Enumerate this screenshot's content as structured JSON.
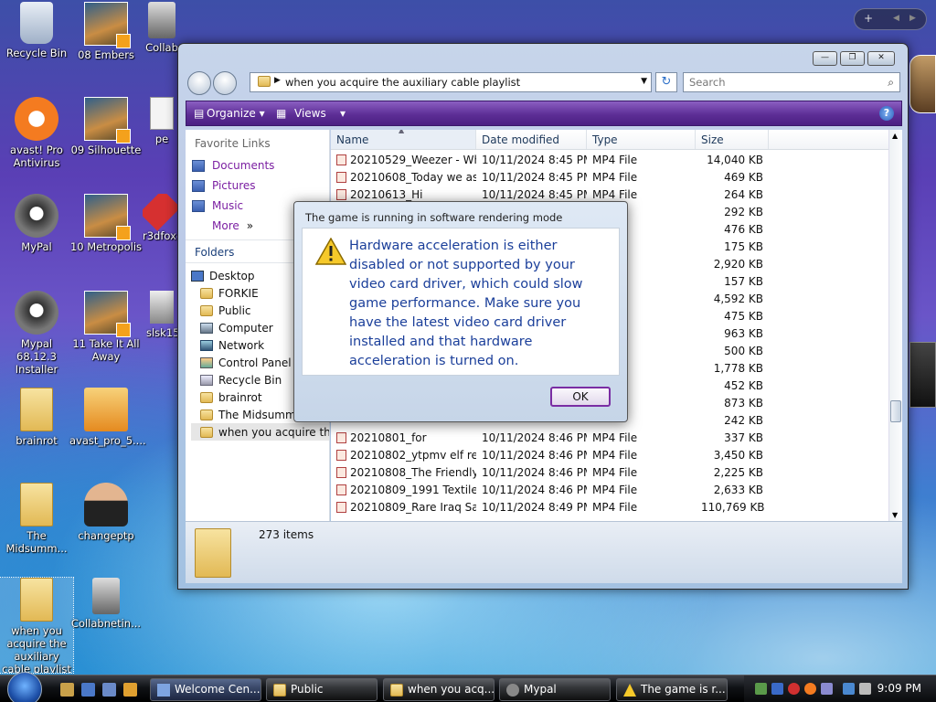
{
  "desktop": {
    "icons": [
      {
        "label": "Recycle Bin"
      },
      {
        "label": "08 Embers"
      },
      {
        "label": "Collab"
      },
      {
        "label": "avast! Pro Antivirus"
      },
      {
        "label": "09 Silhouette"
      },
      {
        "label": "pe"
      },
      {
        "label": "MyPal"
      },
      {
        "label": "10 Metropolis"
      },
      {
        "label": "r3dfox-"
      },
      {
        "label": "Mypal 68.12.3 Installer"
      },
      {
        "label": "11 Take It All Away"
      },
      {
        "label": "slsk157"
      },
      {
        "label": "brainrot"
      },
      {
        "label": "avast_pro_5...."
      },
      {
        "label": "The Midsumm..."
      },
      {
        "label": "changeptp"
      },
      {
        "label": "when you acquire the auxiliary cable playlist"
      },
      {
        "label": "Collabnetin..."
      }
    ],
    "sidebar_pill": {
      "add": "+",
      "prev": "◀",
      "next": "▶"
    }
  },
  "explorer": {
    "window_buttons": {
      "min": "—",
      "max": "❐",
      "close": "✕"
    },
    "address": "when you acquire the auxiliary cable playlist",
    "search_placeholder": "Search",
    "toolbar": {
      "organize": "Organize",
      "views": "Views",
      "help": "?"
    },
    "favorite_links_header": "Favorite Links",
    "favorite_links": [
      "Documents",
      "Pictures",
      "Music",
      "More"
    ],
    "folders_header": "Folders",
    "tree": [
      "Desktop",
      "FORKIE",
      "Public",
      "Computer",
      "Network",
      "Control Panel",
      "Recycle Bin",
      "brainrot",
      "The Midsumm",
      "when you acquire the"
    ],
    "columns": {
      "name": "Name",
      "date": "Date modified",
      "type": "Type",
      "size": "Size"
    },
    "files": [
      {
        "name": "20210529_Weezer - Wh...",
        "date": "10/11/2024 8:45 PM",
        "type": "MP4 File",
        "size": "14,040 KB"
      },
      {
        "name": "20210608_Today we as...",
        "date": "10/11/2024 8:45 PM",
        "type": "MP4 File",
        "size": "469 KB"
      },
      {
        "name": "20210613_Hi",
        "date": "10/11/2024 8:45 PM",
        "type": "MP4 File",
        "size": "264 KB"
      },
      {
        "name": "",
        "date": "",
        "type": "",
        "size": "292 KB"
      },
      {
        "name": "",
        "date": "",
        "type": "",
        "size": "476 KB"
      },
      {
        "name": "",
        "date": "",
        "type": "",
        "size": "175 KB"
      },
      {
        "name": "",
        "date": "",
        "type": "",
        "size": "2,920 KB"
      },
      {
        "name": "",
        "date": "",
        "type": "",
        "size": "157 KB"
      },
      {
        "name": "",
        "date": "",
        "type": "",
        "size": "4,592 KB"
      },
      {
        "name": "",
        "date": "",
        "type": "",
        "size": "475 KB"
      },
      {
        "name": "",
        "date": "",
        "type": "",
        "size": "963 KB"
      },
      {
        "name": "",
        "date": "",
        "type": "",
        "size": "500 KB"
      },
      {
        "name": "",
        "date": "",
        "type": "",
        "size": "1,778 KB"
      },
      {
        "name": "",
        "date": "",
        "type": "",
        "size": "452 KB"
      },
      {
        "name": "",
        "date": "",
        "type": "",
        "size": "873 KB"
      },
      {
        "name": "",
        "date": "",
        "type": "",
        "size": "242 KB"
      },
      {
        "name": "20210801_for",
        "date": "10/11/2024 8:46 PM",
        "type": "MP4 File",
        "size": "337 KB"
      },
      {
        "name": "20210802_ytpmv elf re...",
        "date": "10/11/2024 8:46 PM",
        "type": "MP4 File",
        "size": "3,450 KB"
      },
      {
        "name": "20210808_The Friendly ...",
        "date": "10/11/2024 8:46 PM",
        "type": "MP4 File",
        "size": "2,225 KB"
      },
      {
        "name": "20210809_1991 Textile ...",
        "date": "10/11/2024 8:46 PM",
        "type": "MP4 File",
        "size": "2,633 KB"
      },
      {
        "name": "20210809_Rare Iraq Sad...",
        "date": "10/11/2024 8:49 PM",
        "type": "MP4 File",
        "size": "110,769 KB"
      }
    ],
    "item_count": "273 items"
  },
  "dialog": {
    "title": "The game is running in software rendering mode",
    "message": "Hardware acceleration is either disabled or not supported by your video card driver, which could slow game performance. Make sure you have the latest video card driver installed and that hardware acceleration is turned on.",
    "ok": "OK"
  },
  "taskbar": {
    "tasks": [
      "Welcome Cen...",
      "Public",
      "when you acq...",
      "Mypal",
      "The game is r..."
    ],
    "clock": "9:09 PM"
  },
  "colors": {
    "toolbar": "#5d2e96",
    "link": "#7b1fa2",
    "dialog_text": "#1b3f9a",
    "ok_border": "#7a2da3"
  }
}
